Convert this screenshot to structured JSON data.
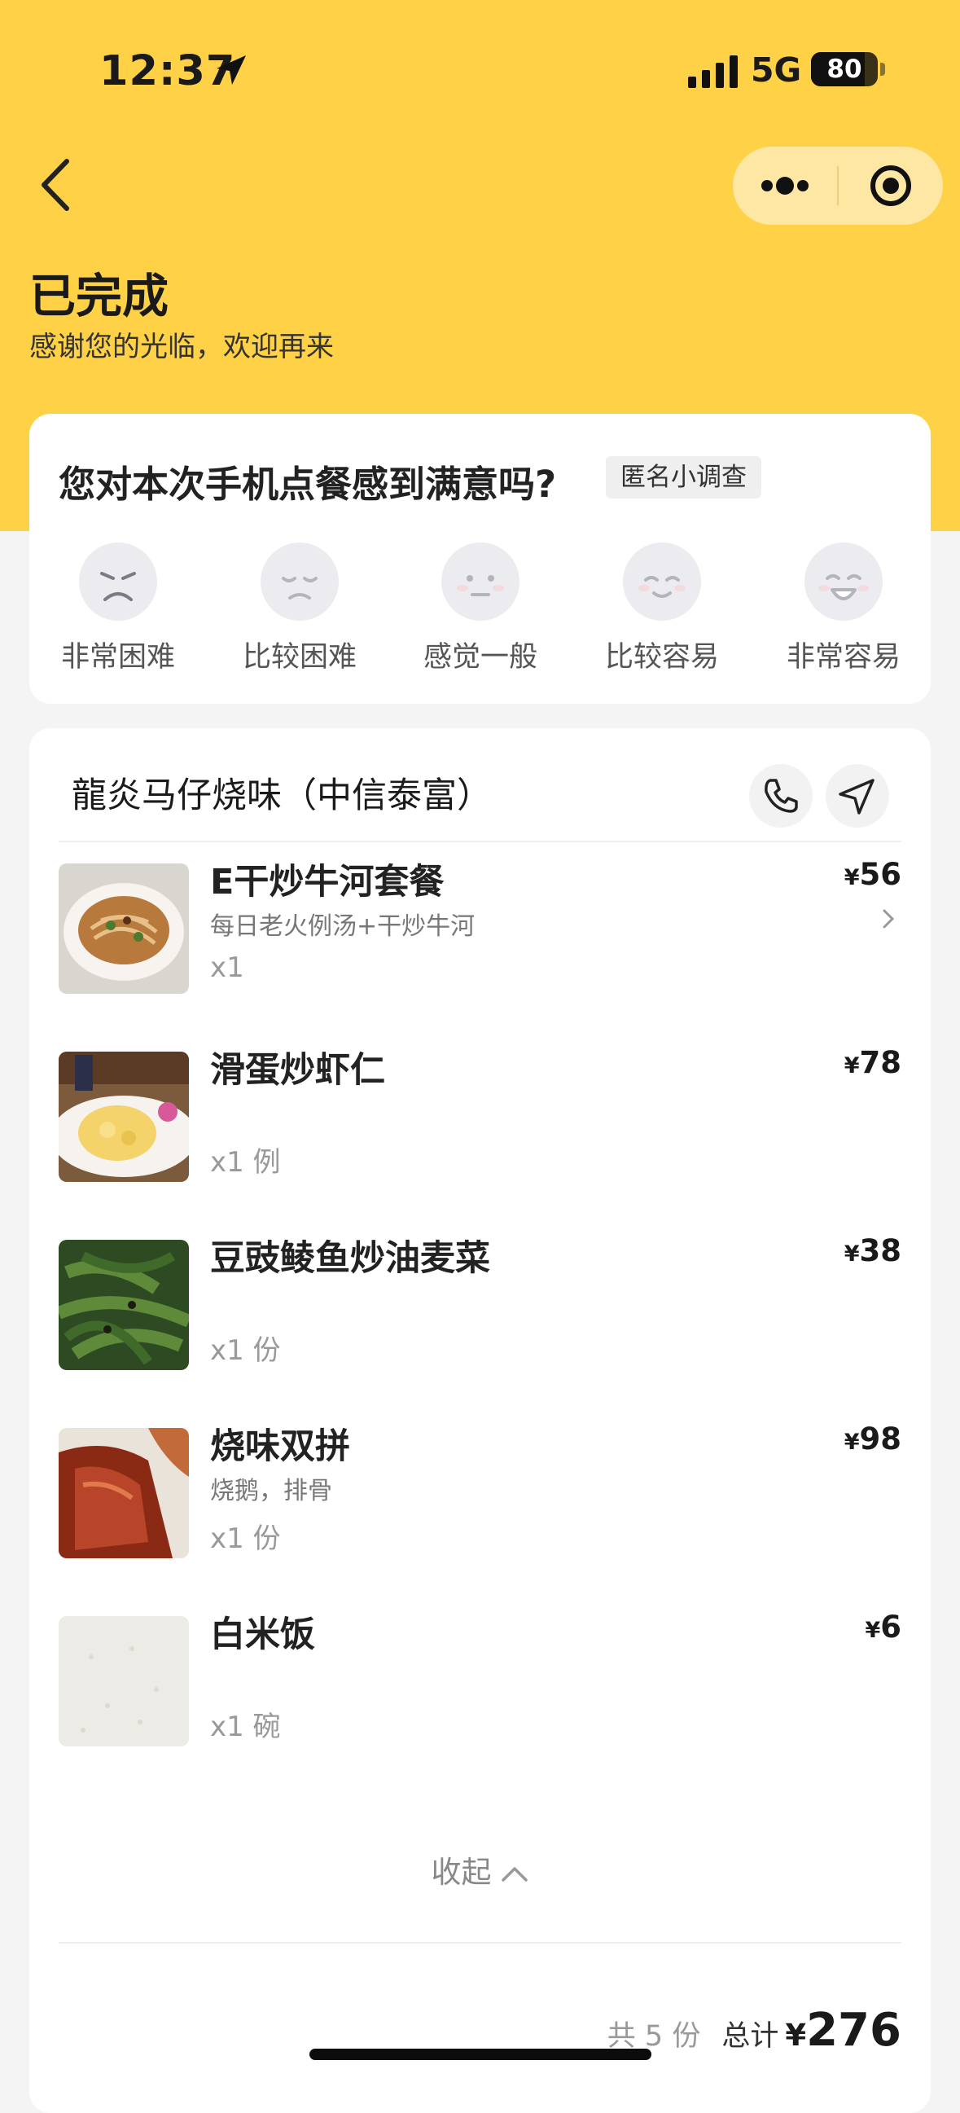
{
  "status_bar": {
    "time": "12:37",
    "network": "5G",
    "battery": 80
  },
  "header": {
    "title": "已完成",
    "subtitle": "感谢您的光临，欢迎再来"
  },
  "survey": {
    "question": "您对本次手机点餐感到满意吗?",
    "tag": "匿名小调查",
    "options": [
      "非常困难",
      "比较困难",
      "感觉一般",
      "比较容易",
      "非常容易"
    ]
  },
  "order": {
    "shop_name": "龍炎马仔烧味（中信泰富）",
    "currency": "¥",
    "items": [
      {
        "name": "E干炒牛河套餐",
        "desc": "每日老火例汤+干炒牛河",
        "qty": "x1",
        "price": "56"
      },
      {
        "name": "滑蛋炒虾仁",
        "desc": "",
        "qty": "x1 例",
        "price": "78"
      },
      {
        "name": "豆豉鲮鱼炒油麦菜",
        "desc": "",
        "qty": "x1 份",
        "price": "38"
      },
      {
        "name": "烧味双拼",
        "desc": "烧鹅，排骨",
        "qty": "x1 份",
        "price": "98"
      },
      {
        "name": "白米饭",
        "desc": "",
        "qty": "x1 碗",
        "price": "6"
      }
    ],
    "collapse_label": "收起",
    "count_text": "共 5 份",
    "total_label": "总计",
    "total": "276"
  },
  "colors": {
    "brand": "#ffd147",
    "capsule": "#fde7a2"
  },
  "icons": [
    "location-arrow-icon",
    "signal-icon",
    "back-chevron-icon",
    "more-icon",
    "target-icon",
    "phone-icon",
    "navigate-icon",
    "chevron-right-icon",
    "chevron-up-icon"
  ]
}
